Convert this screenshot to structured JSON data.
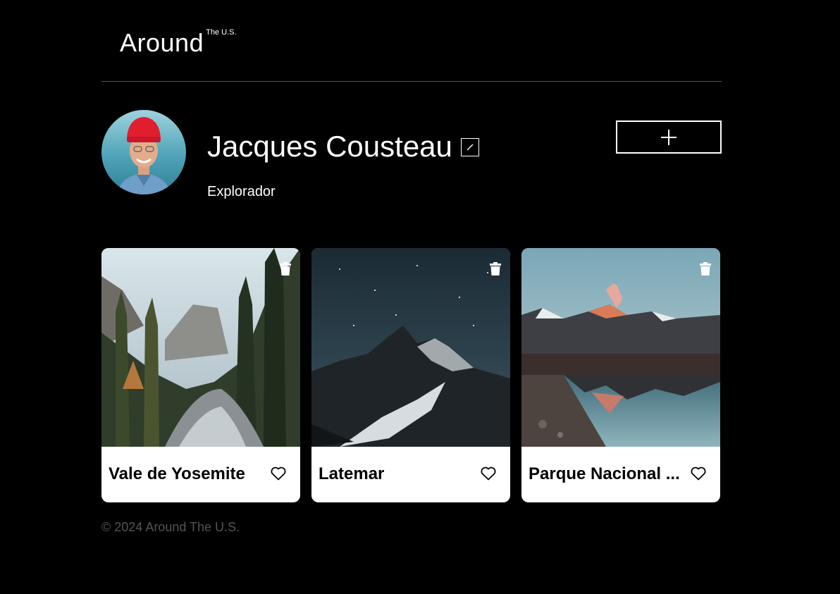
{
  "header": {
    "logo_main": "Around",
    "logo_sup": "The U.S."
  },
  "profile": {
    "name": "Jacques Cousteau",
    "about": "Explorador"
  },
  "cards": [
    {
      "title": "Vale de Yosemite",
      "image": "forest-river-photo"
    },
    {
      "title": "Latemar",
      "image": "night-mountain-photo"
    },
    {
      "title": "Parque Nacional ...",
      "image": "mountain-lake-photo"
    }
  ],
  "footer": {
    "copyright": "© 2024 Around The U.S."
  },
  "icons": {
    "edit": "pencil-icon",
    "add": "plus-icon",
    "delete": "trash-icon",
    "like": "heart-icon"
  },
  "colors": {
    "background": "#000000",
    "card": "#ffffff",
    "divider": "#545454",
    "footer_text": "#545454"
  }
}
